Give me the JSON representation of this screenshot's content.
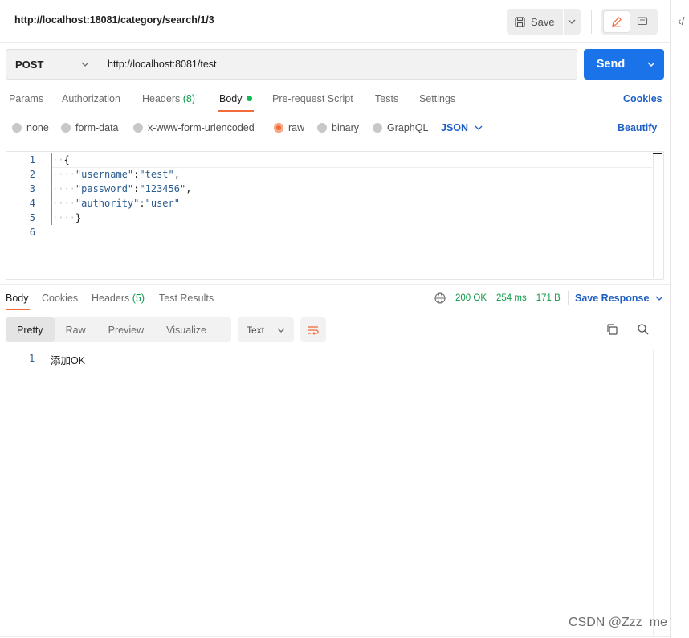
{
  "request": {
    "title": "http://localhost:18081/category/search/1/3",
    "save_label": "Save",
    "method": "POST",
    "url": "http://localhost:8081/test",
    "send_label": "Send"
  },
  "tabs": {
    "params": "Params",
    "authorization": "Authorization",
    "headers": "Headers",
    "headers_count": "(8)",
    "body": "Body",
    "prerequest": "Pre-request Script",
    "tests": "Tests",
    "settings": "Settings",
    "cookies": "Cookies"
  },
  "body_modes": {
    "none": "none",
    "form_data": "form-data",
    "urlencoded": "x-www-form-urlencoded",
    "raw": "raw",
    "binary": "binary",
    "graphql": "GraphQL",
    "language": "JSON",
    "beautify": "Beautify",
    "selected": "raw"
  },
  "editor": {
    "line_numbers": [
      "1",
      "2",
      "3",
      "4",
      "5",
      "6"
    ],
    "open_brace": "{",
    "close_brace": "}",
    "fields": [
      {
        "key": "\"username\"",
        "value": "\"test\"",
        "suffix": ","
      },
      {
        "key": "\"password\"",
        "value": "\"123456\"",
        "suffix": ","
      },
      {
        "key": "\"authority\"",
        "value": "\"user\"",
        "suffix": ""
      }
    ]
  },
  "response": {
    "tabs": {
      "body": "Body",
      "cookies": "Cookies",
      "headers": "Headers",
      "headers_count": "(5)",
      "test_results": "Test Results"
    },
    "status": "200 OK",
    "time": "254 ms",
    "size": "171 B",
    "save_response": "Save Response",
    "views": {
      "pretty": "Pretty",
      "raw": "Raw",
      "preview": "Preview",
      "visualize": "Visualize"
    },
    "format": "Text",
    "line_number": "1",
    "body_text": "添加OK"
  },
  "watermark": "CSDN @Zzz_me",
  "colors": {
    "accent_orange": "#f26b3a",
    "send_blue": "#1a73e8",
    "link_blue": "#1f60c4",
    "ok_green": "#0e9a4a"
  }
}
